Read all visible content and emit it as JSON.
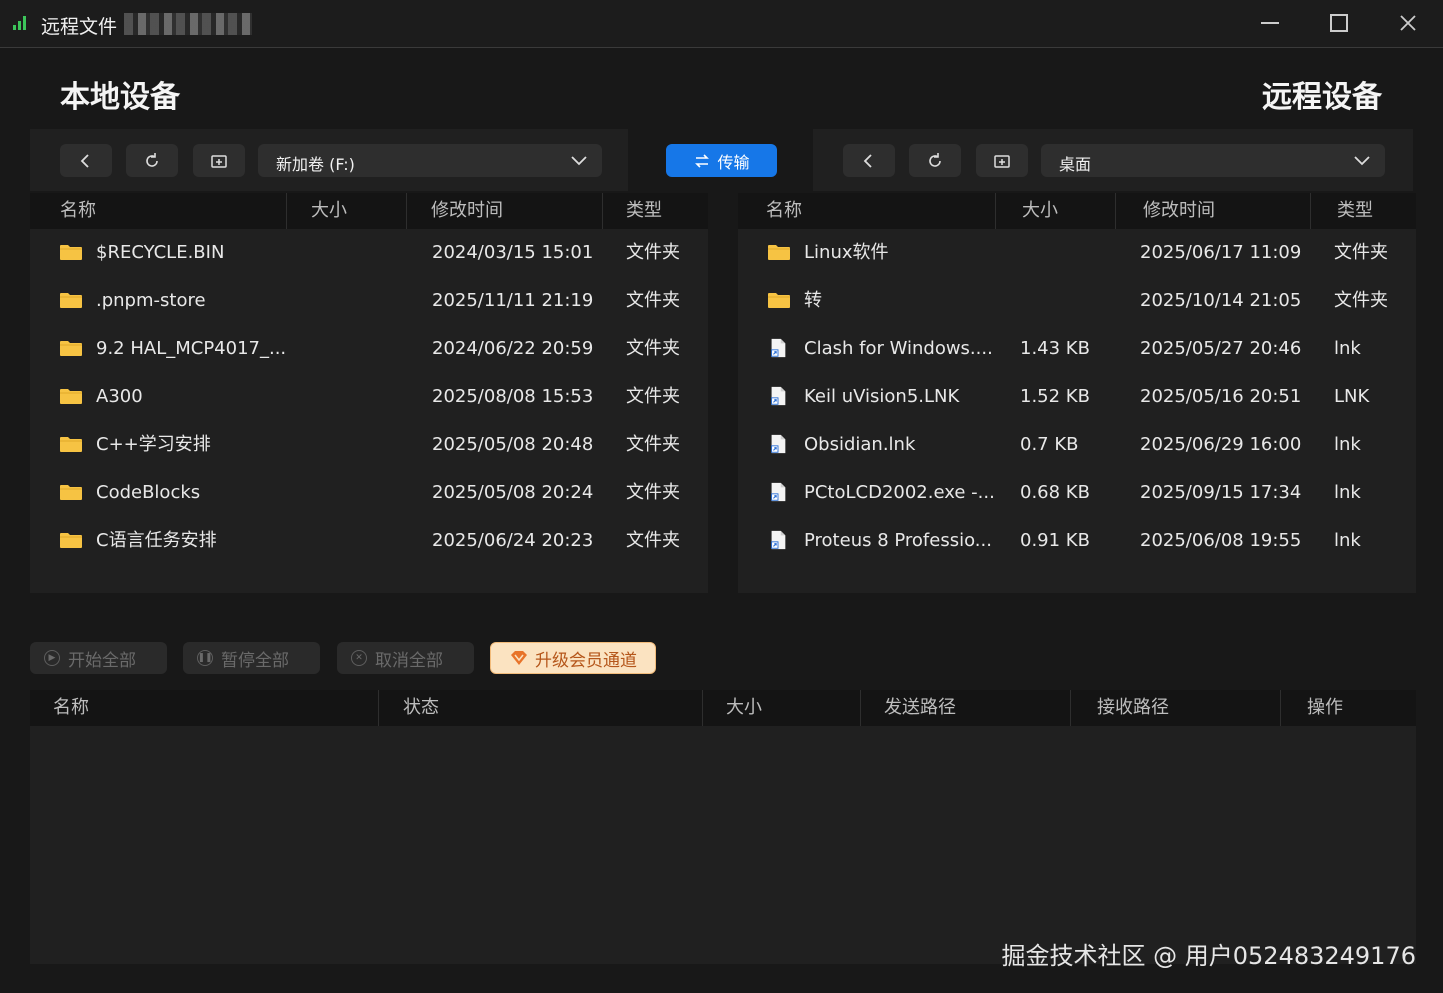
{
  "window": {
    "title": "远程文件",
    "controls": {
      "minimize": "minimize",
      "maximize": "maximize",
      "close": "close"
    }
  },
  "local": {
    "heading": "本地设备",
    "path": "新加卷 (F:)",
    "columns": [
      "名称",
      "大小",
      "修改时间",
      "类型"
    ],
    "files": [
      {
        "name": "$RECYCLE.BIN",
        "size": "",
        "modified": "2024/03/15 15:01",
        "type": "文件夹"
      },
      {
        "name": ".pnpm-store",
        "size": "",
        "modified": "2025/11/11 21:19",
        "type": "文件夹"
      },
      {
        "name": "9.2 HAL_MCP4017_...",
        "size": "",
        "modified": "2024/06/22 20:59",
        "type": "文件夹"
      },
      {
        "name": "A300",
        "size": "",
        "modified": "2025/08/08 15:53",
        "type": "文件夹"
      },
      {
        "name": "C++学习安排",
        "size": "",
        "modified": "2025/05/08 20:48",
        "type": "文件夹"
      },
      {
        "name": "CodeBlocks",
        "size": "",
        "modified": "2025/05/08 20:24",
        "type": "文件夹"
      },
      {
        "name": "C语言任务安排",
        "size": "",
        "modified": "2025/06/24 20:23",
        "type": "文件夹"
      }
    ]
  },
  "remote": {
    "heading": "远程设备",
    "path": "桌面",
    "columns": [
      "名称",
      "大小",
      "修改时间",
      "类型"
    ],
    "files": [
      {
        "name": "Linux软件",
        "size": "",
        "modified": "2025/06/17 11:09",
        "type": "文件夹",
        "icon": "folder"
      },
      {
        "name": "转",
        "size": "",
        "modified": "2025/10/14 21:05",
        "type": "文件夹",
        "icon": "folder"
      },
      {
        "name": "Clash for Windows....",
        "size": "1.43 KB",
        "modified": "2025/05/27 20:46",
        "type": "lnk",
        "icon": "shortcut"
      },
      {
        "name": "Keil uVision5.LNK",
        "size": "1.52 KB",
        "modified": "2025/05/16 20:51",
        "type": "LNK",
        "icon": "shortcut"
      },
      {
        "name": "Obsidian.lnk",
        "size": "0.7 KB",
        "modified": "2025/06/29 16:00",
        "type": "lnk",
        "icon": "shortcut"
      },
      {
        "name": "PCtoLCD2002.exe -...",
        "size": "0.68 KB",
        "modified": "2025/09/15 17:34",
        "type": "lnk",
        "icon": "shortcut"
      },
      {
        "name": "Proteus 8 Professio...",
        "size": "0.91 KB",
        "modified": "2025/06/08 19:55",
        "type": "lnk",
        "icon": "shortcut"
      }
    ]
  },
  "transfer_button": "传输",
  "queue": {
    "buttons": {
      "start_all": "开始全部",
      "pause_all": "暂停全部",
      "cancel_all": "取消全部",
      "upgrade": "升级会员通道"
    },
    "columns": [
      "名称",
      "状态",
      "大小",
      "发送路径",
      "接收路径",
      "操作"
    ]
  },
  "watermark": "掘金技术社区 @ 用户052483249176",
  "colors": {
    "accent": "#1677e8",
    "folder": "#f6c343",
    "vip_bg": "#fbe3c1",
    "vip_text": "#b5561a"
  }
}
